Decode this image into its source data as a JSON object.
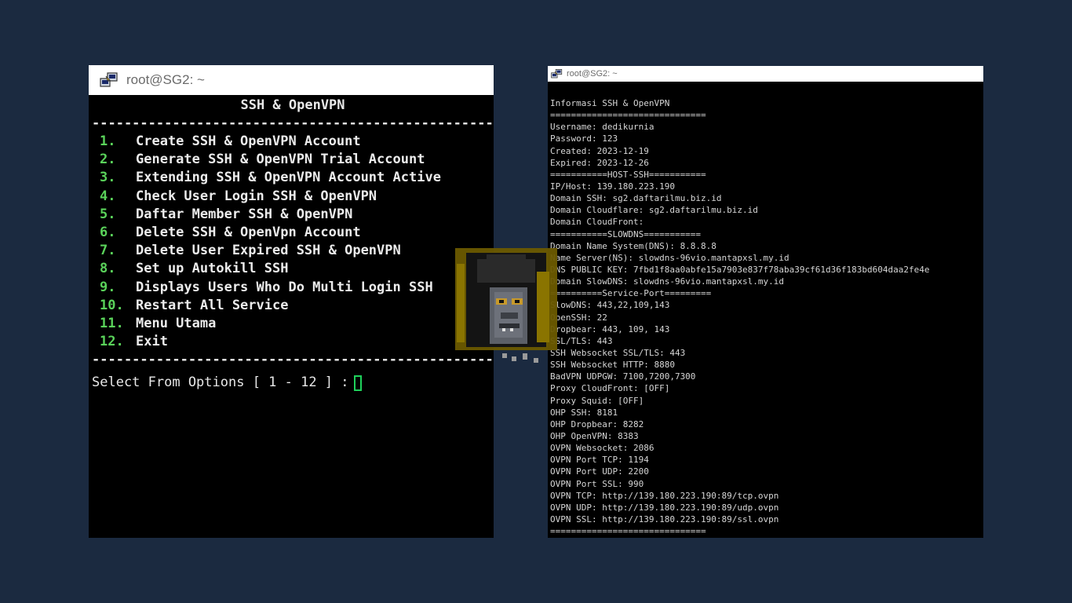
{
  "left_window": {
    "title": "root@SG2: ~",
    "header": "SSH & OpenVPN",
    "separator": "----------------------------------------------------------------",
    "menu": [
      {
        "num": "1.",
        "label": "Create SSH & OpenVPN Account"
      },
      {
        "num": "2.",
        "label": "Generate SSH & OpenVPN Trial Account"
      },
      {
        "num": "3.",
        "label": "Extending SSH & OpenVPN Account Active"
      },
      {
        "num": "4.",
        "label": "Check User Login SSH & OpenVPN"
      },
      {
        "num": "5.",
        "label": "Daftar Member SSH & OpenVPN"
      },
      {
        "num": "6.",
        "label": "Delete SSH & OpenVpn Account"
      },
      {
        "num": "7.",
        "label": "Delete User Expired SSH & OpenVPN"
      },
      {
        "num": "8.",
        "label": "Set up Autokill SSH"
      },
      {
        "num": "9.",
        "label": "Displays Users Who Do Multi Login SSH"
      },
      {
        "num": "10.",
        "label": "Restart All Service"
      },
      {
        "num": "11.",
        "label": "Menu Utama"
      },
      {
        "num": "12.",
        "label": "Exit"
      }
    ],
    "prompt": "Select From Options [ 1 - 12 ] :"
  },
  "right_window": {
    "title": "root@SG2: ~",
    "lines": [
      "Informasi SSH & OpenVPN",
      "==============================",
      "Username: dedikurnia",
      "Password: 123",
      "Created: 2023-12-19",
      "Expired: 2023-12-26",
      "===========HOST-SSH===========",
      "IP/Host: 139.180.223.190",
      "Domain SSH: sg2.daftarilmu.biz.id",
      "Domain Cloudflare: sg2.daftarilmu.biz.id",
      "Domain CloudFront:",
      "===========SLOWDNS===========",
      "Domain Name System(DNS): 8.8.8.8",
      "Name Server(NS): slowdns-96vio.mantapxsl.my.id",
      "DNS PUBLIC KEY: 7fbd1f8aa0abfe15a7903e837f78aba39cf61d36f183bd604daa2fe4e",
      "Domain SlowDNS: slowdns-96vio.mantapxsl.my.id",
      "==========Service-Port=========",
      "SlowDNS: 443,22,109,143",
      "OpenSSH: 22",
      "Dropbear: 443, 109, 143",
      "SSL/TLS: 443",
      "SSH Websocket SSL/TLS: 443",
      "SSH Websocket HTTP: 8880",
      "BadVPN UDPGW: 7100,7200,7300",
      "Proxy CloudFront: [OFF]",
      "Proxy Squid: [OFF]",
      "OHP SSH: 8181",
      "OHP Dropbear: 8282",
      "OHP OpenVPN: 8383",
      "OVPN Websocket: 2086",
      "OVPN Port TCP: 1194",
      "OVPN Port UDP: 2200",
      "OVPN Port SSL: 990",
      "OVPN TCP: http://139.180.223.190:89/tcp.ovpn",
      "OVPN UDP: http://139.180.223.190:89/udp.ovpn",
      "OVPN SSL: http://139.180.223.190:89/ssl.ovpn",
      "=============================="
    ]
  },
  "colors": {
    "background": "#1b2a40",
    "terminal_bg": "#000000",
    "menu_number": "#5ad25a",
    "cursor": "#1fd15b",
    "titlebar_bg": "#ffffff",
    "titlebar_text": "#6b6b6b"
  },
  "icons": {
    "window_icon": "putty-icon",
    "overlay": "pixel-gorilla-mascot"
  }
}
